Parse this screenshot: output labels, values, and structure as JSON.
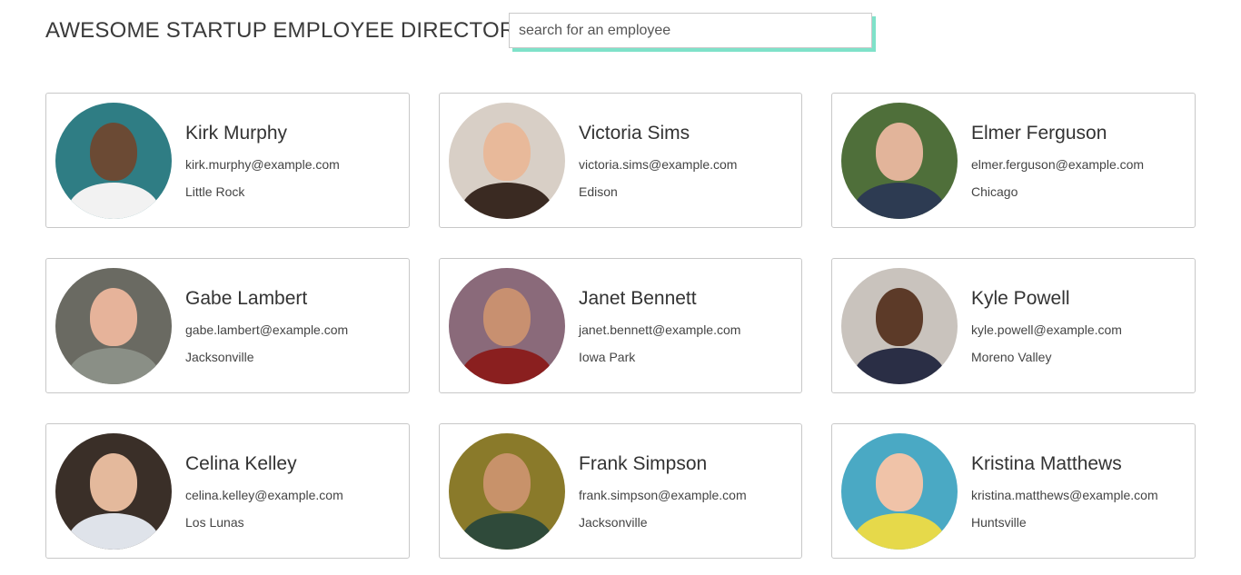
{
  "header": {
    "title": "AWESOME STARTUP EMPLOYEE DIRECTORY",
    "search_placeholder": "search for an employee",
    "accent_color": "#7fe2c9"
  },
  "employees": [
    {
      "name": "Kirk Murphy",
      "email": "kirk.murphy@example.com",
      "city": "Little Rock",
      "bg": "#2f7d84",
      "skin": "#6b4a34",
      "shirt": "#f2f2f2"
    },
    {
      "name": "Victoria Sims",
      "email": "victoria.sims@example.com",
      "city": "Edison",
      "bg": "#d8cfc6",
      "skin": "#e8b99a",
      "shirt": "#3a2a22"
    },
    {
      "name": "Elmer Ferguson",
      "email": "elmer.ferguson@example.com",
      "city": "Chicago",
      "bg": "#4f6f3a",
      "skin": "#e2b49a",
      "shirt": "#2d3b52"
    },
    {
      "name": "Gabe Lambert",
      "email": "gabe.lambert@example.com",
      "city": "Jacksonville",
      "bg": "#6a6a62",
      "skin": "#e6b39a",
      "shirt": "#8a8f86"
    },
    {
      "name": "Janet Bennett",
      "email": "janet.bennett@example.com",
      "city": "Iowa Park",
      "bg": "#8a6a7a",
      "skin": "#c89070",
      "shirt": "#8a1f1f"
    },
    {
      "name": "Kyle Powell",
      "email": "kyle.powell@example.com",
      "city": "Moreno Valley",
      "bg": "#c9c3bd",
      "skin": "#5c3a28",
      "shirt": "#2a2e45"
    },
    {
      "name": "Celina Kelley",
      "email": "celina.kelley@example.com",
      "city": "Los Lunas",
      "bg": "#3a2f28",
      "skin": "#e4b99c",
      "shirt": "#dfe3ea"
    },
    {
      "name": "Frank Simpson",
      "email": "frank.simpson@example.com",
      "city": "Jacksonville",
      "bg": "#8a7a2a",
      "skin": "#c8926a",
      "shirt": "#2f4a3a"
    },
    {
      "name": "Kristina Matthews",
      "email": "kristina.matthews@example.com",
      "city": "Huntsville",
      "bg": "#4aa9c4",
      "skin": "#f0c3a8",
      "shirt": "#e6d94a"
    }
  ]
}
